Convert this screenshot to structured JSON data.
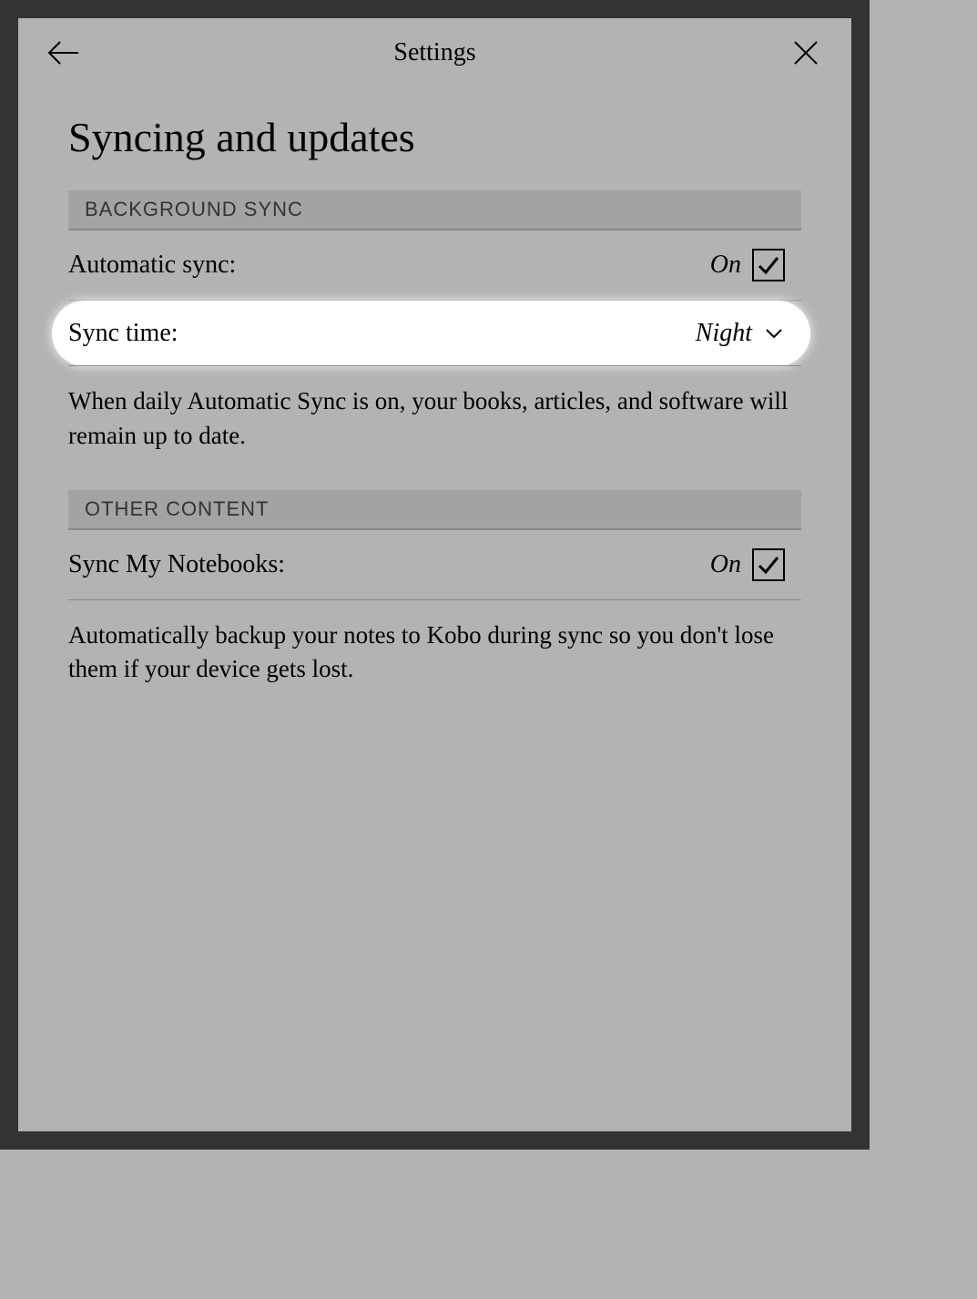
{
  "header": {
    "title": "Settings"
  },
  "page": {
    "title": "Syncing and updates"
  },
  "sections": {
    "background_sync": {
      "header": "BACKGROUND SYNC",
      "automatic_sync": {
        "label": "Automatic sync:",
        "value": "On",
        "checked": true
      },
      "sync_time": {
        "label": "Sync time:",
        "value": "Night"
      },
      "description": "When daily Automatic Sync is on, your books, articles, and software will remain up to date."
    },
    "other_content": {
      "header": "OTHER CONTENT",
      "sync_notebooks": {
        "label": "Sync My Notebooks:",
        "value": "On",
        "checked": true
      },
      "description": "Automatically backup your notes to Kobo during sync so you don't lose them if your device gets lost."
    }
  }
}
